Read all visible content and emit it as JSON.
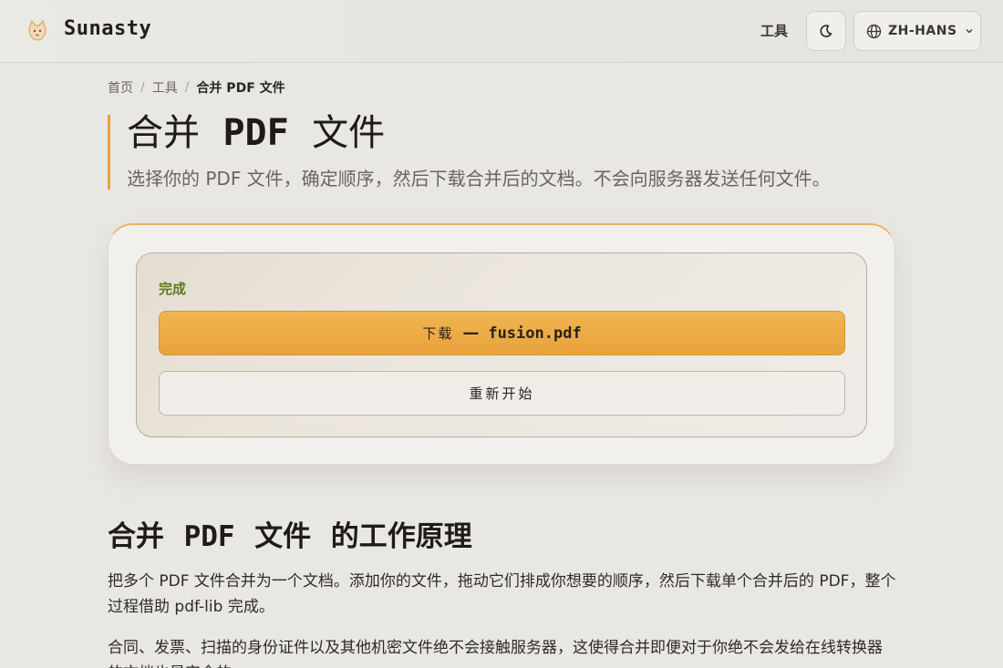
{
  "header": {
    "brand": "Sunasty",
    "nav_tools": "工具",
    "lang_label": "ZH-HANS",
    "icons": {
      "logo": "cat-logo-icon",
      "theme": "moon-icon",
      "lang": "globe-icon",
      "caret": "chevron-down-icon"
    }
  },
  "breadcrumb": {
    "home": "首页",
    "sep": "/",
    "tools": "工具",
    "current": "合并 PDF 文件"
  },
  "hero": {
    "title_pre": "合并",
    "title_mono": "PDF",
    "title_post": "文件",
    "subtitle": "选择你的 PDF 文件，确定顺序，然后下载合并后的文档。不会向服务器发送任何文件。"
  },
  "result": {
    "status": "完成",
    "download_label": "下载",
    "download_dash": "—",
    "file_name": "fusion.pdf",
    "restart_label": "重新开始"
  },
  "how": {
    "title_pre": "合并",
    "title_mono": "PDF",
    "title_mid": "文件",
    "title_post": "的工作原理",
    "para1": "把多个 PDF 文件合并为一个文档。添加你的文件，拖动它们排成你想要的顺序，然后下载单个合并后的 PDF，整个过程借助 pdf-lib 完成。",
    "para2": "合同、发票、扫描的身份证件以及其他机密文件绝不会接触服务器，这使得合并即便对于你绝不会发给在线转换器的文档也是安全的。"
  },
  "colors": {
    "accent": "#e8a23f",
    "status": "#5e7a1e",
    "background": "#e9e7e2"
  }
}
